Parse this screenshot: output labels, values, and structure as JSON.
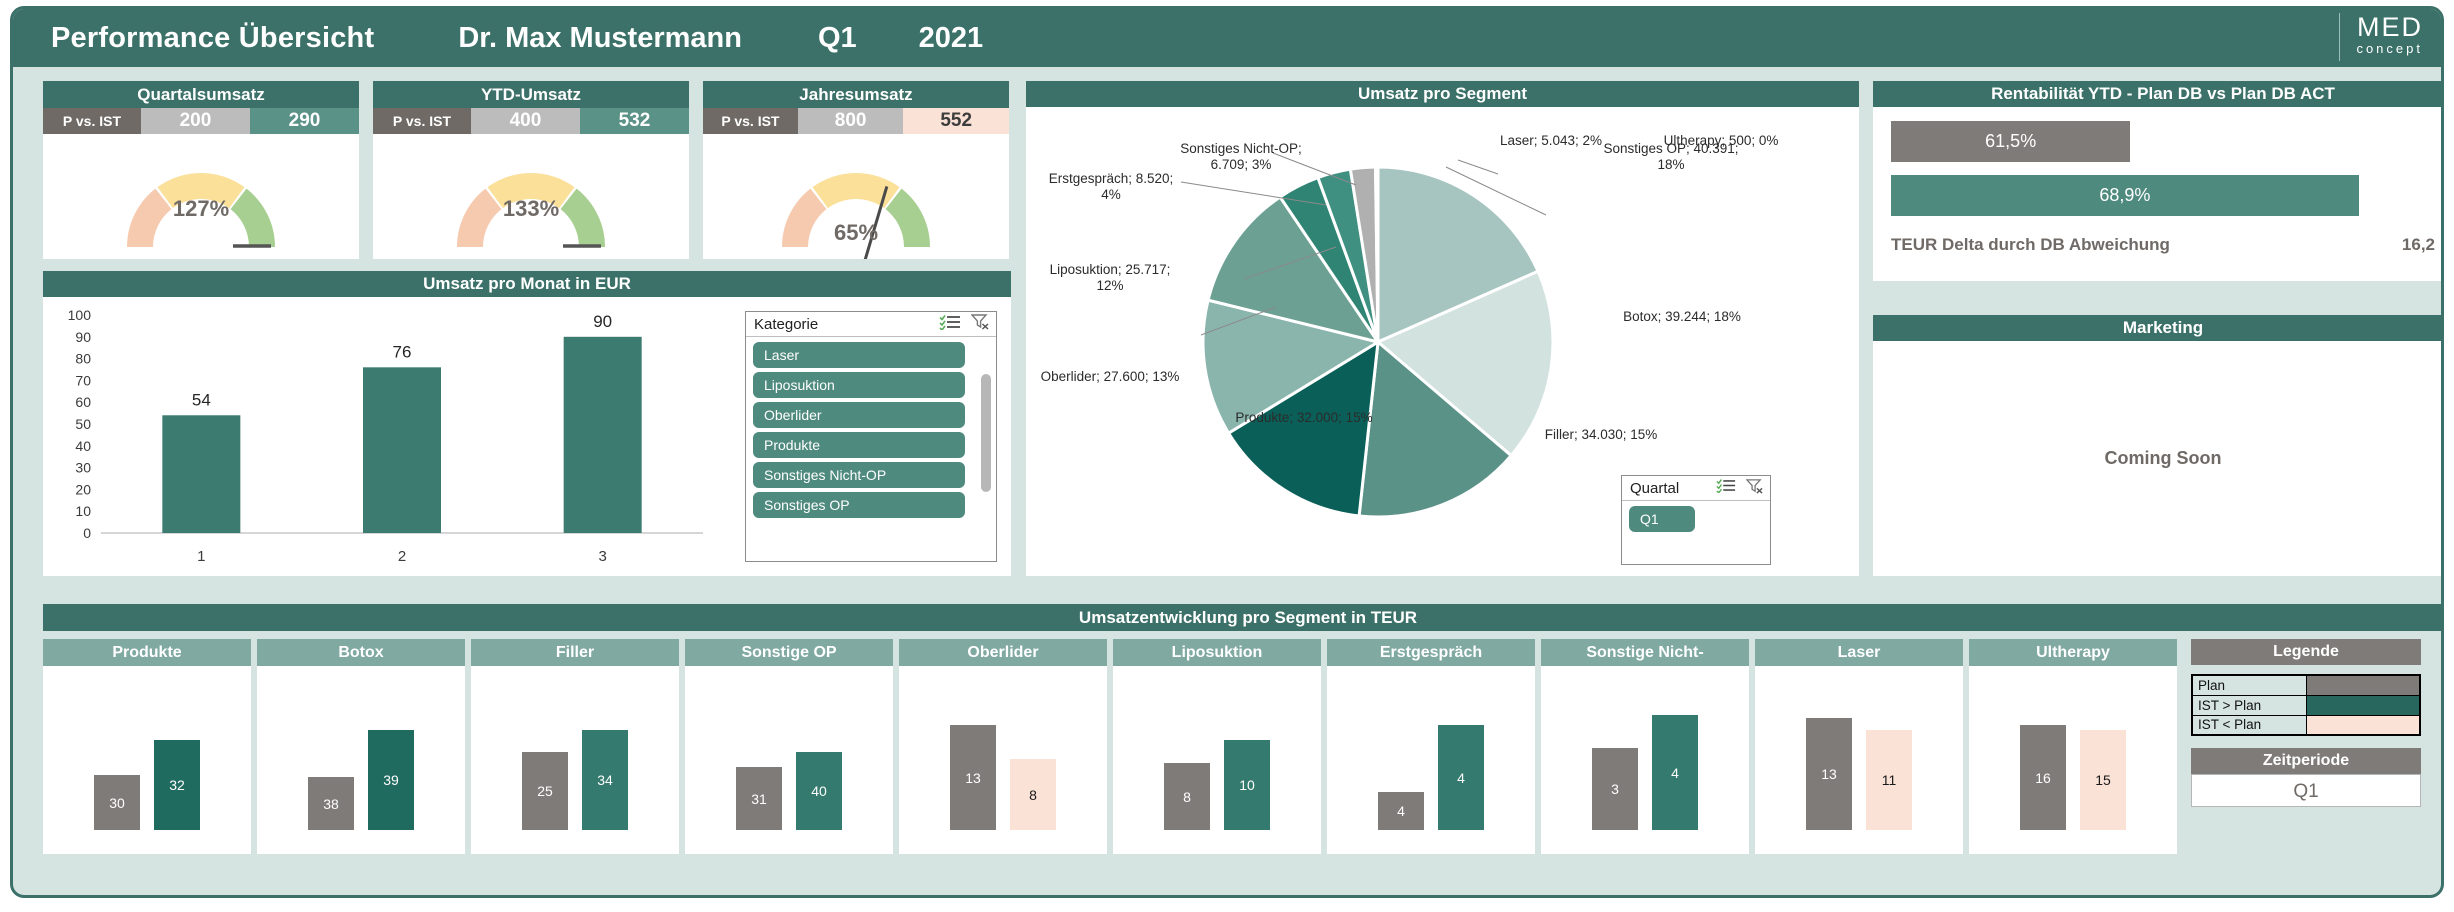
{
  "header": {
    "title": "Performance Übersicht",
    "doctor": "Dr. Max Mustermann",
    "quarter": "Q1",
    "year": "2021",
    "logo_main": "MED",
    "logo_sub": "concept"
  },
  "colors": {
    "brand_dark": "#3b7168",
    "brand_mid": "#4f8a7f",
    "brand_light": "#7fa9a1",
    "page_bg": "#d6e4e1",
    "plan_gray": "#7f7b78",
    "good_teal": "#1f6b60",
    "bad_peach": "#fae2d7",
    "gauge_red": "#f6caaf",
    "gauge_yellow": "#fbe09a",
    "gauge_green": "#a8cf92"
  },
  "kpis": [
    {
      "title": "Quartalsumsatz",
      "row_label": "P vs. IST",
      "plan": "200",
      "ist": "290",
      "ist_state": "good",
      "percent_label": "127%",
      "percent_value": 127
    },
    {
      "title": "YTD-Umsatz",
      "row_label": "P vs. IST",
      "plan": "400",
      "ist": "532",
      "ist_state": "good",
      "percent_label": "133%",
      "percent_value": 133
    },
    {
      "title": "Jahresumsatz",
      "row_label": "P vs. IST",
      "plan": "800",
      "ist": "552",
      "ist_state": "bad",
      "percent_label": "65%",
      "percent_value": 65
    }
  ],
  "month_chart": {
    "title": "Umsatz pro Monat in EUR",
    "chart_data": {
      "type": "bar",
      "title": "Umsatz pro Monat in EUR",
      "categories": [
        "1",
        "2",
        "3"
      ],
      "values": [
        54,
        76,
        90
      ],
      "xlabel": "",
      "ylabel": "",
      "ylim": [
        0,
        100
      ],
      "yticks": [
        0,
        10,
        20,
        30,
        40,
        50,
        60,
        70,
        80,
        90,
        100
      ],
      "grid": false
    }
  },
  "kategorie_slicer": {
    "name": "Kategorie",
    "multiselect_icon": "multi-select-icon",
    "clearfilter_icon": "clear-filter-icon",
    "items": [
      "Laser",
      "Liposuktion",
      "Oberlider",
      "Produkte",
      "Sonstiges Nicht-OP",
      "Sonstiges OP"
    ]
  },
  "pie_panel": {
    "title": "Umsatz pro Segment",
    "chart_data": {
      "type": "pie",
      "title": "Umsatz pro Segment",
      "labels": [
        "Sonstiges OP",
        "Botox",
        "Filler",
        "Produkte",
        "Oberlider",
        "Liposuktion",
        "Erstgespräch",
        "Sonstiges Nicht-OP",
        "Laser",
        "Ultherapy"
      ],
      "values": [
        40391,
        39244,
        34030,
        32000,
        27600,
        25717,
        8520,
        6709,
        5043,
        500
      ],
      "percents": [
        18,
        18,
        15,
        15,
        13,
        12,
        4,
        3,
        2,
        0
      ],
      "label_texts": [
        "Sonstiges OP; 40.391;\n18%",
        "Botox; 39.244; 18%",
        "Filler; 34.030; 15%",
        "Produkte; 32.000; 15%",
        "Oberlider; 27.600; 13%",
        "Liposuktion; 25.717;\n12%",
        "Erstgespräch; 8.520;\n4%",
        "Sonstiges Nicht-OP;\n6.709; 3%",
        "Laser; 5.043; 2%",
        "Ultherapy; 500; 0%"
      ],
      "slice_colors": [
        "#a7c5c0",
        "#d2e2df",
        "#5b9288",
        "#0a6059",
        "#8ab5ad",
        "#6ba093",
        "#2f8473",
        "#3f9081",
        "#b0b0b0",
        "#dcdcdc"
      ]
    }
  },
  "quartal_slicer": {
    "name": "Quartal",
    "multiselect_icon": "multi-select-icon",
    "clearfilter_icon": "clear-filter-icon",
    "items": [
      "Q1"
    ]
  },
  "rentabilitaet": {
    "title": "Rentabilität YTD - Plan DB vs Plan DB ACT",
    "chart_data": {
      "type": "bar",
      "orientation": "horizontal",
      "categories": [
        "Plan DB",
        "Plan DB ACT"
      ],
      "values": [
        61.5,
        68.9
      ],
      "labels": [
        "61,5%",
        "68,9%"
      ],
      "ylim": [
        0,
        100
      ]
    },
    "plan_label": "61,5%",
    "act_label": "68,9%",
    "footer_label": "TEUR Delta durch DB Abweichung",
    "footer_value": "16,2"
  },
  "marketing": {
    "title": "Marketing",
    "body": "Coming Soon"
  },
  "bottom": {
    "title": "Umsatzentwicklung pro Segment in TEUR",
    "chart_data": {
      "type": "bar",
      "title": "Umsatzentwicklung pro Segment in TEUR",
      "series": [
        {
          "name": "Plan",
          "values": [
            30,
            38,
            25,
            31,
            13,
            8,
            4,
            3,
            13,
            16
          ]
        },
        {
          "name": "IST",
          "values": [
            32,
            39,
            34,
            40,
            8,
            10,
            4,
            4,
            11,
            15
          ]
        }
      ],
      "categories": [
        "Produkte",
        "Botox",
        "Filler",
        "Sonstige OP",
        "Oberlider",
        "Liposuktion",
        "Erstgespräch",
        "Sonstige Nicht-",
        "Laser",
        "Ultherapy"
      ]
    },
    "cards": [
      {
        "title": "Produkte",
        "plan": "30",
        "ist": "32",
        "plan_h": 55,
        "ist_h": 90,
        "state": "up"
      },
      {
        "title": "Botox",
        "plan": "38",
        "ist": "39",
        "plan_h": 53,
        "ist_h": 100,
        "state": "up"
      },
      {
        "title": "Filler",
        "plan": "25",
        "ist": "34",
        "plan_h": 78,
        "ist_h": 100,
        "state": "up2"
      },
      {
        "title": "Sonstige OP",
        "plan": "31",
        "ist": "40",
        "plan_h": 63,
        "ist_h": 78,
        "state": "up2"
      },
      {
        "title": "Oberlider",
        "plan": "13",
        "ist": "8",
        "plan_h": 105,
        "ist_h": 71,
        "state": "down"
      },
      {
        "title": "Liposuktion",
        "plan": "8",
        "ist": "10",
        "plan_h": 67,
        "ist_h": 90,
        "state": "up2"
      },
      {
        "title": "Erstgespräch",
        "plan": "4",
        "ist": "4",
        "plan_h": 38,
        "ist_h": 105,
        "state": "up2"
      },
      {
        "title": "Sonstige Nicht-",
        "plan": "3",
        "ist": "4",
        "plan_h": 82,
        "ist_h": 115,
        "state": "up2"
      },
      {
        "title": "Laser",
        "plan": "13",
        "ist": "11",
        "plan_h": 112,
        "ist_h": 100,
        "state": "down"
      },
      {
        "title": "Ultherapy",
        "plan": "16",
        "ist": "15",
        "plan_h": 105,
        "ist_h": 100,
        "state": "down"
      }
    ]
  },
  "legend": {
    "title": "Legende",
    "rows": [
      {
        "label": "Plan",
        "color": "#7f7b78"
      },
      {
        "label": "IST > Plan",
        "color": "#27675d"
      },
      {
        "label": "IST < Plan",
        "color": "#fae2d7"
      }
    ],
    "zeitperiode_title": "Zeitperiode",
    "zeitperiode_value": "Q1"
  }
}
